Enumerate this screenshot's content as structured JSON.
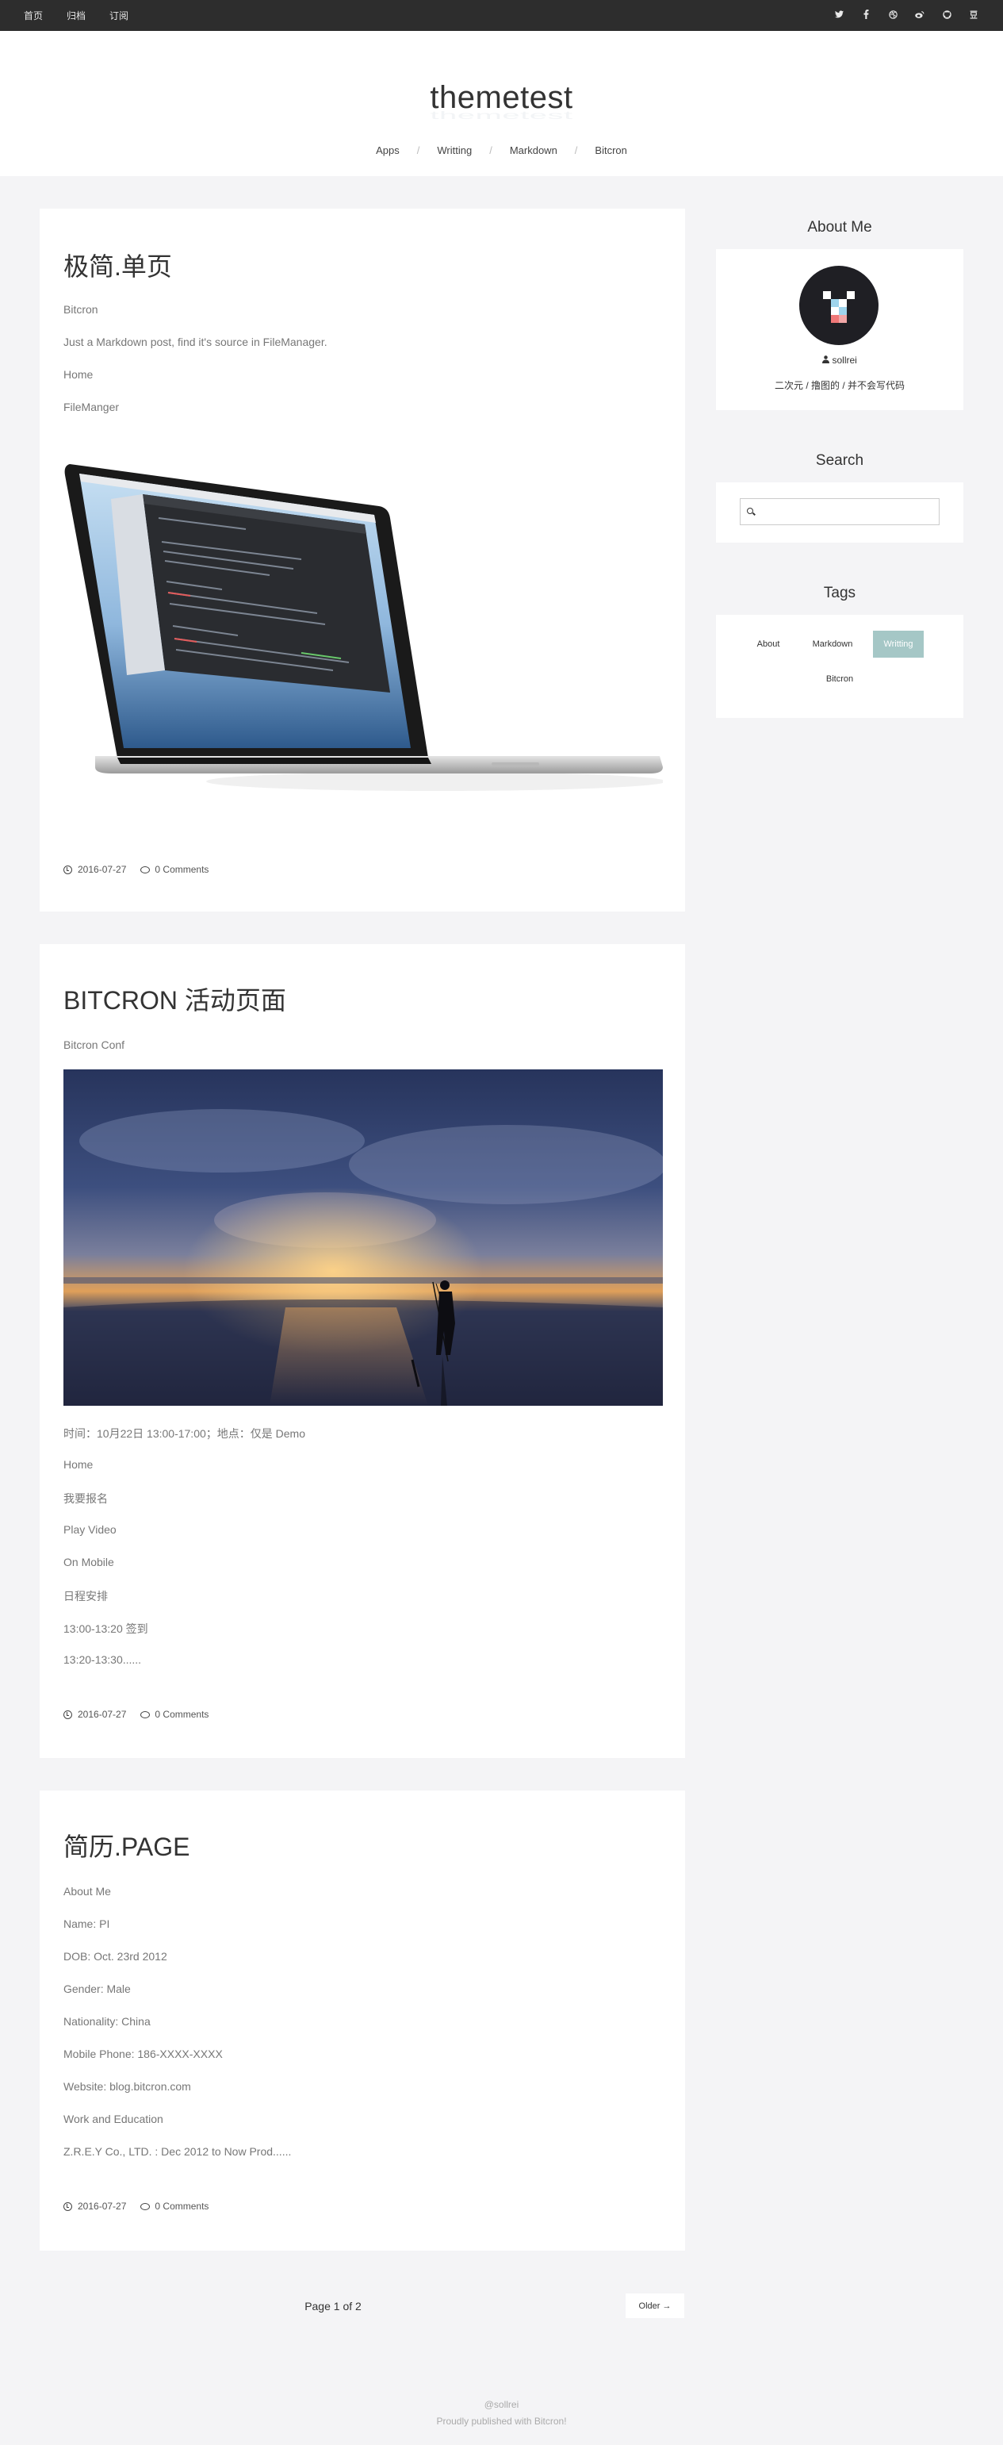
{
  "topbar": {
    "nav": [
      "首页",
      "归档",
      "订阅"
    ],
    "social_icons": [
      "twitter-icon",
      "facebook-icon",
      "dribbble-icon",
      "weibo-icon",
      "github-icon",
      "douban-icon"
    ]
  },
  "header": {
    "site_title": "themetest",
    "nav": [
      "Apps",
      "Writting",
      "Markdown",
      "Bitcron"
    ]
  },
  "posts": [
    {
      "title": "极简.单页",
      "lines": [
        "Bitcron",
        "Just a Markdown post, find it's source in FileManager.",
        "Home",
        "FileManger"
      ],
      "date": "2016-07-27",
      "comments": "0 Comments"
    },
    {
      "title": "BITCRON 活动页面",
      "subtitle": "Bitcron Conf",
      "lines": [
        "时间：10月22日 13:00-17:00；地点：仅是 Demo",
        "Home",
        "我要报名",
        "Play Video",
        "On Mobile",
        "日程安排",
        "13:00-13:20 签到",
        "13:20-13:30......"
      ],
      "date": "2016-07-27",
      "comments": "0 Comments"
    },
    {
      "title": "简历.PAGE",
      "lines": [
        "About Me",
        "Name: PI",
        "DOB: Oct. 23rd 2012",
        "Gender: Male",
        "Nationality: China",
        "Mobile Phone: 186-XXXX-XXXX",
        "Website: blog.bitcron.com",
        "Work and Education",
        "Z.R.E.Y Co., LTD. : Dec 2012 to Now Prod......"
      ],
      "date": "2016-07-27",
      "comments": "0 Comments"
    }
  ],
  "sidebar": {
    "about": {
      "title": "About Me",
      "username": "sollrei",
      "motto": "二次元 / 撸图的 / 并不会写代码"
    },
    "search": {
      "title": "Search",
      "placeholder": ""
    },
    "tags": {
      "title": "Tags",
      "items": [
        "About",
        "Markdown",
        "Writting",
        "Bitcron"
      ],
      "active": "Writting"
    }
  },
  "pagination": {
    "page_text": "Page 1 of 2",
    "older_label": "Older →"
  },
  "footer": {
    "line1": "@sollrei",
    "line2": "Proudly published with Bitcron!"
  },
  "colors": {
    "topbar": "#2d2d2d",
    "tag_active": "#a5c7c6",
    "background": "#f4f4f6"
  }
}
